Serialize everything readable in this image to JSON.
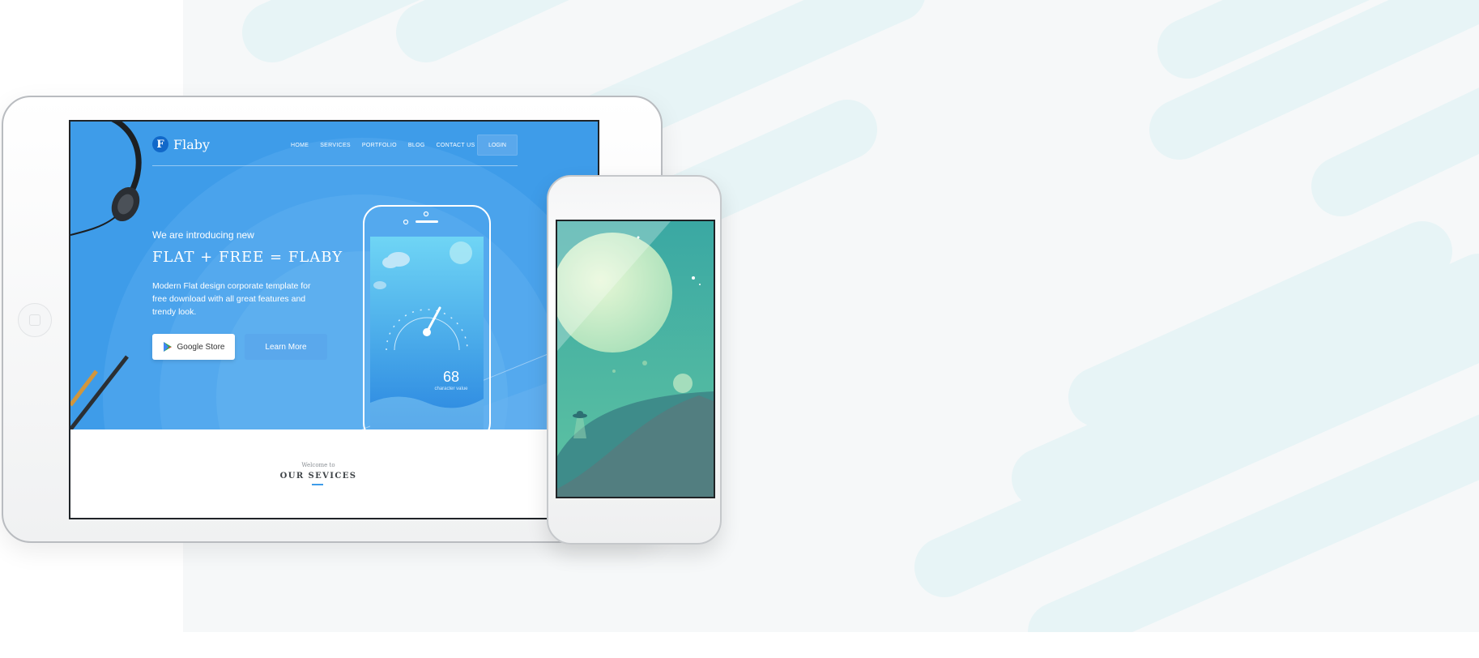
{
  "tablet_site": {
    "logo": {
      "mark": "F",
      "name": "Flaby"
    },
    "nav": [
      "HOME",
      "SERVICES",
      "PORTFOLIO",
      "BLOG",
      "CONTACT US"
    ],
    "login_label": "LOGIN",
    "hero": {
      "intro": "We are introducing new",
      "headline": "FLAT + FREE = FLABY",
      "description": "Modern Flat design corporate template for free download with all great features and trendy look.",
      "google_button": "Google Store",
      "learn_button": "Learn More",
      "gauge_value": "68",
      "gauge_label": "character value"
    },
    "section": {
      "welcome": "Welcome to",
      "title": "OUR SEVICES"
    }
  },
  "colors": {
    "hero_blue": "#3e9ce9",
    "panel_bg": "#f6f8f9",
    "panel_shapes": "#e6f3f5",
    "phone_teal": "#3ca9a4"
  },
  "icons": [
    "headphones-icon",
    "pencil-icon",
    "google-play-icon",
    "cloud-icon",
    "planet-icon",
    "ufo-icon"
  ]
}
